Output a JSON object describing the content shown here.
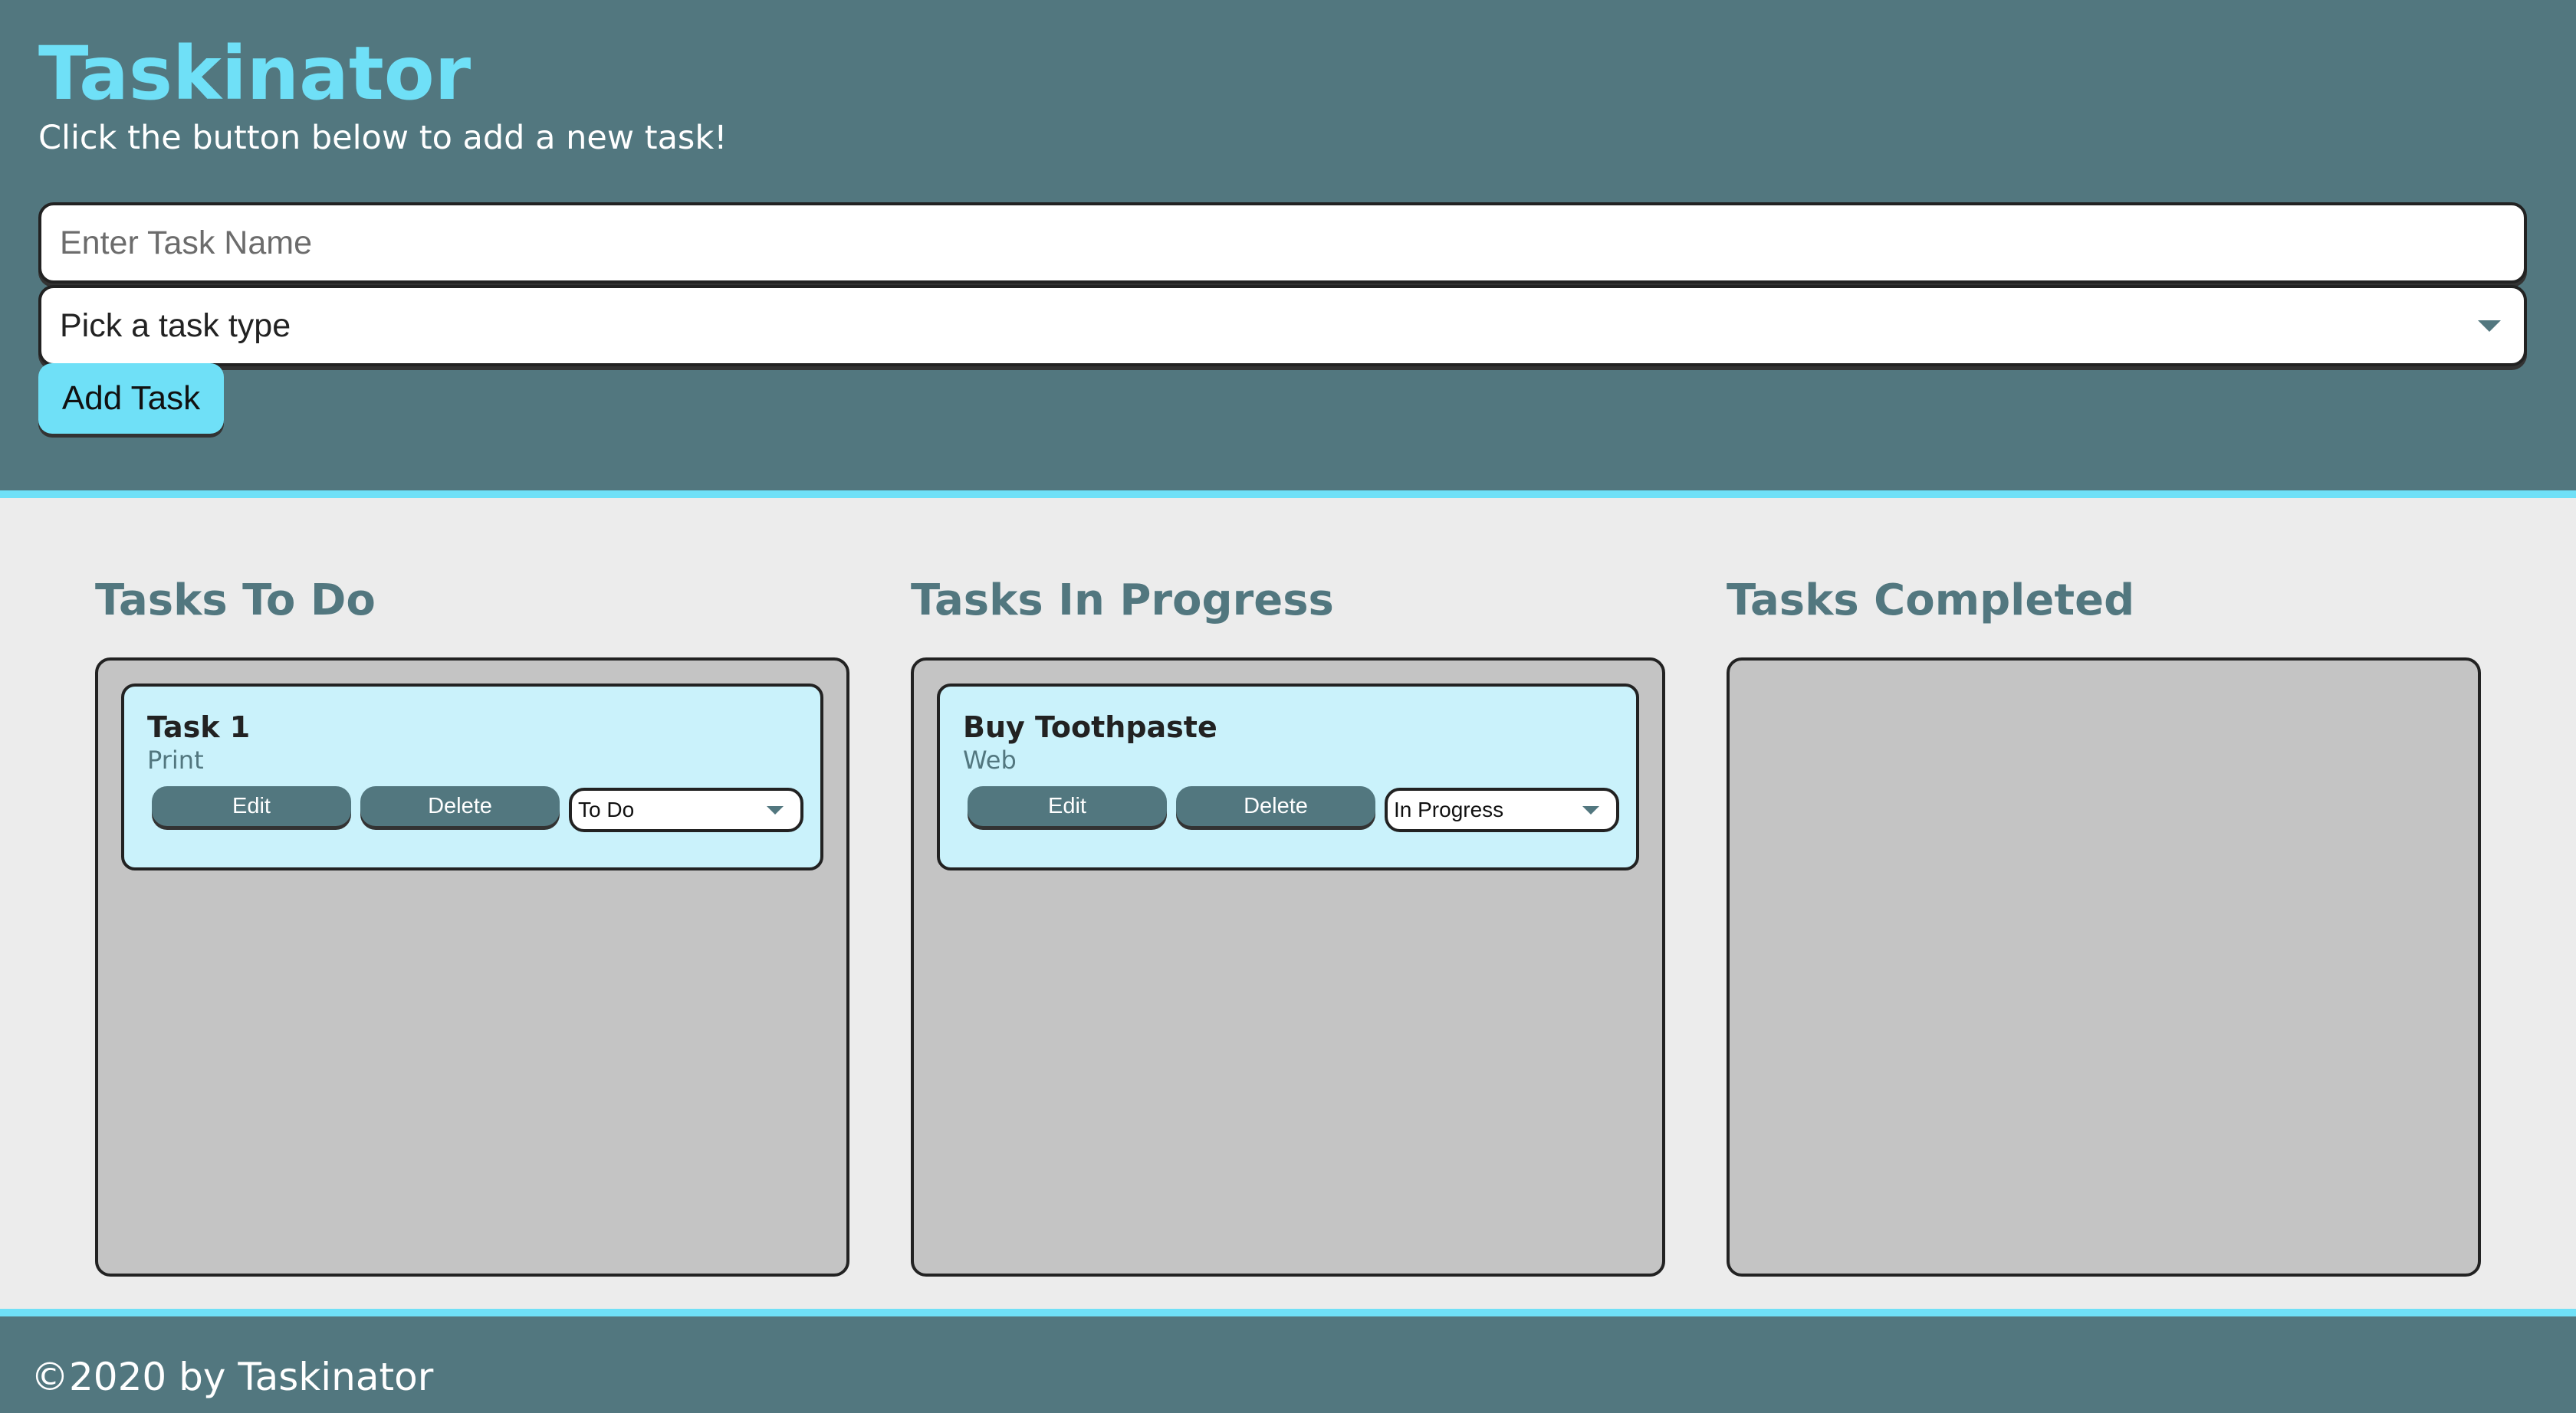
{
  "header": {
    "title": "Taskinator",
    "subtitle": "Click the button below to add a new task!",
    "task_name_placeholder": "Enter Task Name",
    "task_type_placeholder": "Pick a task type",
    "add_button_label": "Add Task"
  },
  "columns": [
    {
      "title": "Tasks To Do",
      "tasks": [
        {
          "name": "Task 1",
          "type": "Print",
          "edit_label": "Edit",
          "delete_label": "Delete",
          "status": "To Do"
        }
      ]
    },
    {
      "title": "Tasks In Progress",
      "tasks": [
        {
          "name": "Buy Toothpaste",
          "type": "Web",
          "edit_label": "Edit",
          "delete_label": "Delete",
          "status": "In Progress"
        }
      ]
    },
    {
      "title": "Tasks Completed",
      "tasks": []
    }
  ],
  "footer": {
    "text": "©2020 by Taskinator"
  },
  "colors": {
    "primary": "#52777f",
    "accent": "#6fe0f7",
    "card": "#caf2fb",
    "list_bg": "#c4c4c4",
    "page_bg": "#ececec"
  },
  "icons": {
    "dropdown": "chevron-down-icon"
  }
}
